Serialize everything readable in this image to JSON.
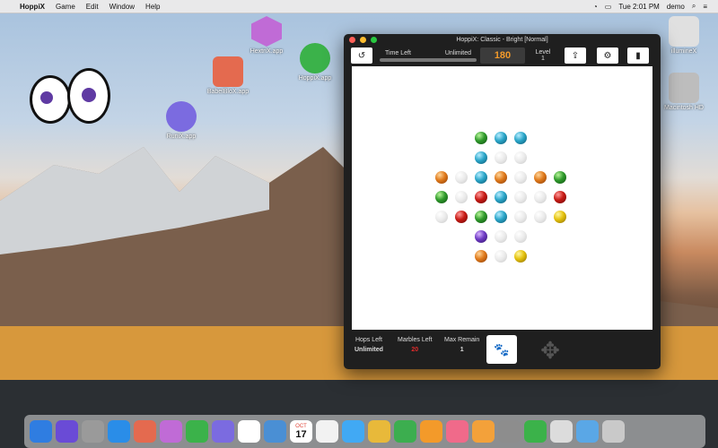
{
  "menubar": {
    "apple_icon": "apple-icon",
    "app_name": "HoppiX",
    "items": [
      "Game",
      "Edit",
      "Window",
      "Help"
    ],
    "clock": "Tue 2:01 PM",
    "user": "demo"
  },
  "desktop_icons": [
    {
      "name": "HextriX.app",
      "color": "#c06bd6"
    },
    {
      "name": "BabelBloX.app",
      "color": "#e46a4f"
    },
    {
      "name": "HoppiX.app",
      "color": "#3bb24a"
    },
    {
      "name": "RuniX.app",
      "color": "#7b6be0"
    },
    {
      "name": "illumineX",
      "color": "#cfcfcf"
    },
    {
      "name": "Macintosh HD",
      "color": "#9a9a9a"
    }
  ],
  "window": {
    "title": "HoppiX:  Classic - Bright [Normal]",
    "toolbar": {
      "time_left_label": "Time Left",
      "time_left_value": "Unlimited",
      "score": "180",
      "level_label": "Level",
      "level_value": "1"
    },
    "footer": {
      "hops_left_label": "Hops Left",
      "hops_left_value": "Unlimited",
      "marbles_left_label": "Marbles Left",
      "marbles_left_value": "20",
      "max_remain_label": "Max Remain",
      "max_remain_value": "1"
    }
  },
  "board": {
    "row_labels": [],
    "marbles": [
      {
        "row": 0,
        "col": 2,
        "color": "green"
      },
      {
        "row": 0,
        "col": 3,
        "color": "blue"
      },
      {
        "row": 0,
        "col": 4,
        "color": "blue"
      },
      {
        "row": 1,
        "col": 2,
        "color": "blue"
      },
      {
        "row": 1,
        "col": 3,
        "color": "empty"
      },
      {
        "row": 1,
        "col": 4,
        "color": "empty"
      },
      {
        "row": 2,
        "col": 0,
        "color": "orange"
      },
      {
        "row": 2,
        "col": 1,
        "color": "empty"
      },
      {
        "row": 2,
        "col": 2,
        "color": "blue"
      },
      {
        "row": 2,
        "col": 3,
        "color": "orange"
      },
      {
        "row": 2,
        "col": 4,
        "color": "empty"
      },
      {
        "row": 2,
        "col": 5,
        "color": "orange"
      },
      {
        "row": 2,
        "col": 6,
        "color": "green"
      },
      {
        "row": 3,
        "col": 0,
        "color": "green"
      },
      {
        "row": 3,
        "col": 1,
        "color": "empty"
      },
      {
        "row": 3,
        "col": 2,
        "color": "red"
      },
      {
        "row": 3,
        "col": 3,
        "color": "blue"
      },
      {
        "row": 3,
        "col": 4,
        "color": "empty"
      },
      {
        "row": 3,
        "col": 5,
        "color": "empty"
      },
      {
        "row": 3,
        "col": 6,
        "color": "red"
      },
      {
        "row": 4,
        "col": 0,
        "color": "empty"
      },
      {
        "row": 4,
        "col": 1,
        "color": "red"
      },
      {
        "row": 4,
        "col": 2,
        "color": "green"
      },
      {
        "row": 4,
        "col": 3,
        "color": "blue"
      },
      {
        "row": 4,
        "col": 4,
        "color": "empty"
      },
      {
        "row": 4,
        "col": 5,
        "color": "empty"
      },
      {
        "row": 4,
        "col": 6,
        "color": "yellow"
      },
      {
        "row": 5,
        "col": 2,
        "color": "purple"
      },
      {
        "row": 5,
        "col": 3,
        "color": "empty"
      },
      {
        "row": 5,
        "col": 4,
        "color": "empty"
      },
      {
        "row": 6,
        "col": 2,
        "color": "orange"
      },
      {
        "row": 6,
        "col": 3,
        "color": "empty"
      },
      {
        "row": 6,
        "col": 4,
        "color": "yellow"
      }
    ]
  },
  "dock": {
    "icons": [
      "finder-icon",
      "siri-icon",
      "launchpad-icon",
      "safari-icon",
      "babelblox-icon",
      "hextrix-icon",
      "hoppix-icon",
      "runix-icon",
      "eyes-icon",
      "photos-slideshow-icon",
      "calendar-icon",
      "photos-icon",
      "messages-icon",
      "keynote-icon",
      "numbers-icon",
      "pages-icon",
      "itunes-icon",
      "ibooks-icon",
      "system-preferences-icon",
      "hoppix-dock-icon",
      "preview-icon",
      "downloads-folder-icon",
      "trash-icon"
    ],
    "calendar_month": "OCT",
    "calendar_day": "17"
  }
}
